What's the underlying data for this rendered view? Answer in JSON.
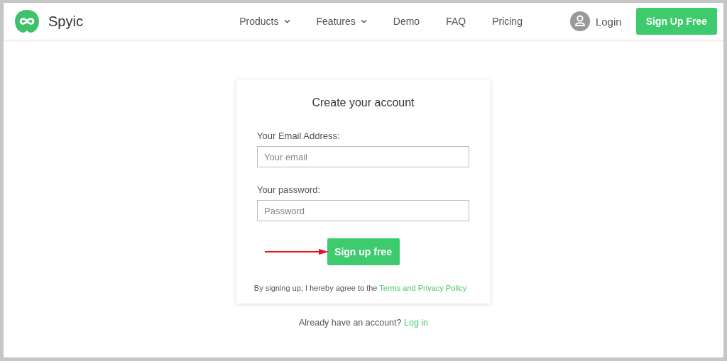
{
  "header": {
    "brand": "Spyic",
    "nav": [
      {
        "label": "Products",
        "dropdown": true
      },
      {
        "label": "Features",
        "dropdown": true
      },
      {
        "label": "Demo",
        "dropdown": false
      },
      {
        "label": "FAQ",
        "dropdown": false
      },
      {
        "label": "Pricing",
        "dropdown": false
      }
    ],
    "login": "Login",
    "signup": "Sign Up Free"
  },
  "form": {
    "title": "Create your account",
    "fields": [
      {
        "label": "Your Email Address:",
        "placeholder": "Your email"
      },
      {
        "label": "Your password:",
        "placeholder": "Password"
      }
    ],
    "submit": "Sign up free",
    "terms_text": "By signing up, I hereby agree to the",
    "terms_link": "Terms and Privacy Policy"
  },
  "footer": {
    "text": "Already have an account?",
    "link": "Log in"
  }
}
